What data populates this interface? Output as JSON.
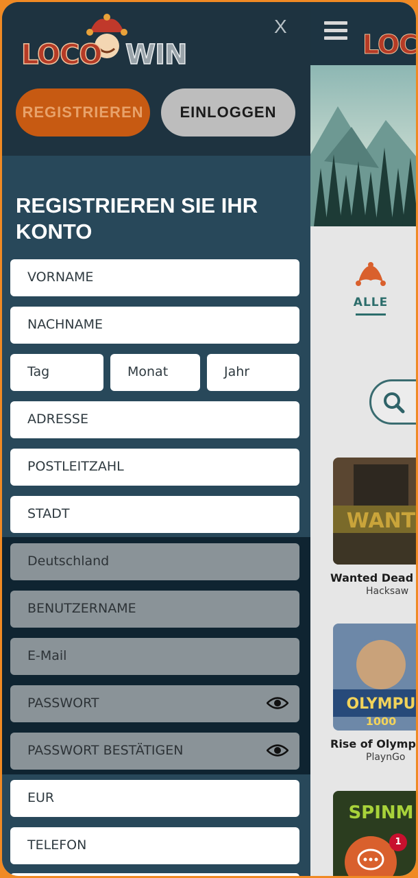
{
  "drawer": {
    "close_label": "X",
    "logo": {
      "part1": "LOCO",
      "part2": "WIN"
    },
    "register_button": "REGISTRIEREN",
    "login_button": "EINLOGGEN",
    "form_title": "REGISTRIEREN SIE IHR KONTO",
    "fields": {
      "first_name": "VORNAME",
      "last_name": "NACHNAME",
      "day": "Tag",
      "month": "Monat",
      "year": "Jahr",
      "address": "ADRESSE",
      "postal_code": "POSTLEITZAHL",
      "city": "STADT",
      "country": "Deutschland",
      "username": "BENUTZERNAME",
      "email": "E-Mail",
      "password": "PASSWORT",
      "password_confirm": "PASSWORT BESTÄTIGEN",
      "currency": "EUR",
      "phone": "TELEFON"
    }
  },
  "background": {
    "logo_text": "LOCO",
    "category_label": "ALLE",
    "games": [
      {
        "name": "Wanted Dead o",
        "provider": "Hacksaw"
      },
      {
        "name": "Rise of Olympu",
        "provider": "PlaynGo"
      }
    ],
    "chat_badge": "1"
  },
  "colors": {
    "frame": "#f08a24",
    "drawer_bg": "#28485a",
    "drawer_top": "#1e3340",
    "register_button": "#c75a12",
    "accent_teal": "#2c6d6b"
  }
}
